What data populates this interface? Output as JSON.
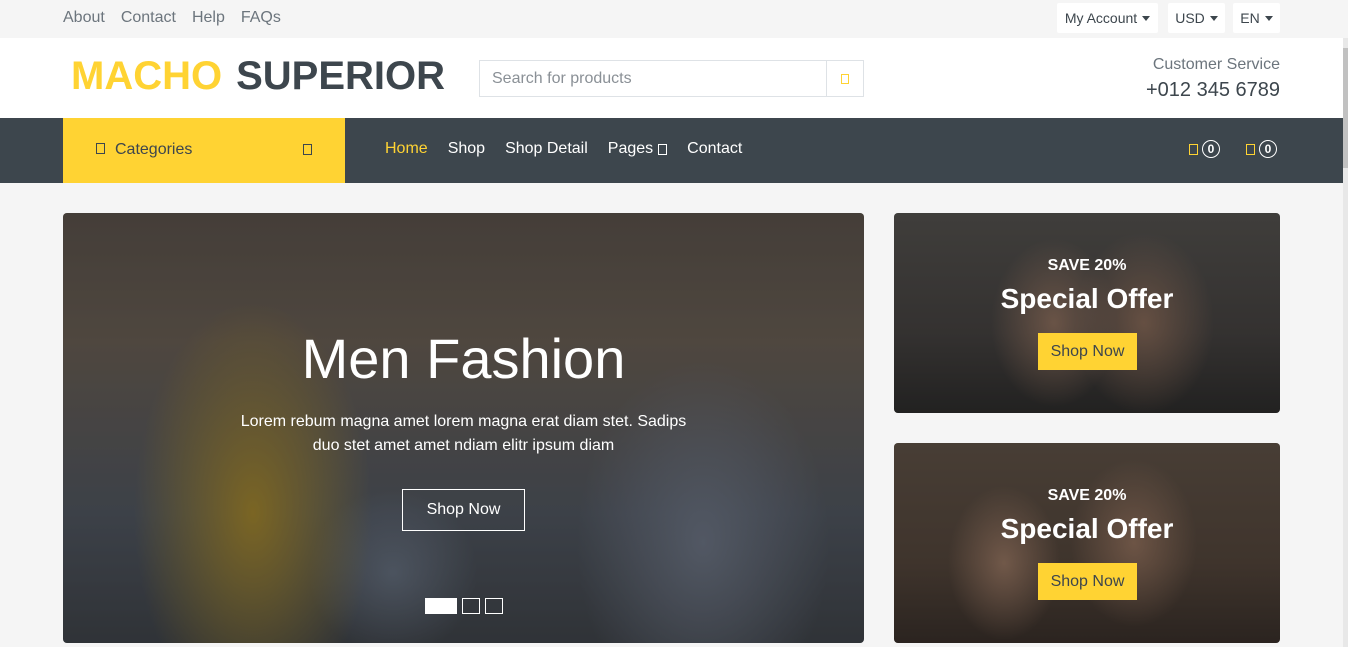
{
  "topbar": {
    "links": [
      "About",
      "Contact",
      "Help",
      "FAQs"
    ],
    "account_label": "My Account",
    "currency_label": "USD",
    "language_label": "EN"
  },
  "header": {
    "logo_part1": "MACHO",
    "logo_part2": "SUPERIOR",
    "search_placeholder": "Search for products",
    "search_icon": "search-icon",
    "service_label": "Customer Service",
    "service_phone": "+012 345 6789"
  },
  "nav": {
    "categories_label": "Categories",
    "links": [
      "Home",
      "Shop",
      "Shop Detail",
      "Pages",
      "Contact"
    ],
    "active_link": "Home",
    "wishlist_count": "0",
    "cart_count": "0"
  },
  "hero": {
    "title": "Men Fashion",
    "text": "Lorem rebum magna amet lorem magna erat diam stet. Sadips duo stet amet amet ndiam elitr ipsum diam",
    "button_label": "Shop Now",
    "slide_count": 3,
    "active_slide": 1
  },
  "offers": [
    {
      "save_label": "SAVE 20%",
      "title": "Special Offer",
      "button_label": "Shop Now"
    },
    {
      "save_label": "SAVE 20%",
      "title": "Special Offer",
      "button_label": "Shop Now"
    }
  ],
  "colors": {
    "accent": "#ffd333",
    "dark": "#3d464d",
    "muted": "#6c757d",
    "background": "#f5f5f5"
  }
}
